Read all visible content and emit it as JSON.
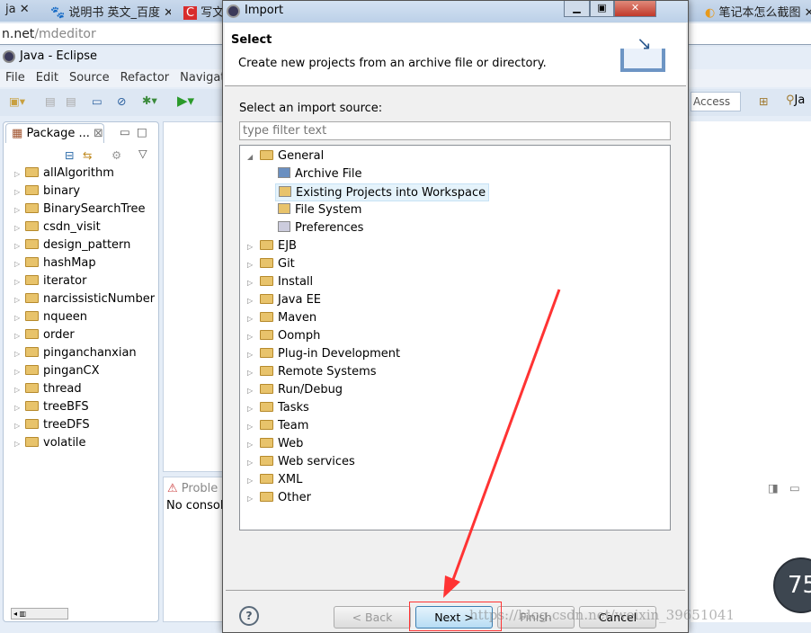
{
  "browser": {
    "tabs": [
      {
        "label": "ja"
      },
      {
        "label": "说明书 英文_百度"
      },
      {
        "label": "写文"
      },
      {
        "label": "笔记本怎么截图"
      }
    ],
    "address": {
      "host": "n.net",
      "path": "/mdeditor"
    }
  },
  "eclipse": {
    "title": "Java - Eclipse",
    "menu": [
      "File",
      "Edit",
      "Source",
      "Refactor",
      "Navigate"
    ],
    "quick_access": "Access",
    "perspective": "Ja",
    "package_explorer": {
      "tab": "Package ...",
      "projects": [
        "allAlgorithm",
        "binary",
        "BinarySearchTree",
        "csdn_visit",
        "design_pattern",
        "hashMap",
        "iterator",
        "narcissisticNumber",
        "nqueen",
        "order",
        "pinganchanxian",
        "pinganCX",
        "thread",
        "treeBFS",
        "treeDFS",
        "volatile"
      ]
    },
    "problems_tab": "Proble",
    "console_text": "No consol"
  },
  "dialog": {
    "title": "Import",
    "heading": "Select",
    "description": "Create new projects from an archive file or directory.",
    "source_label": "Select an import source:",
    "filter_placeholder": "type filter text",
    "tree": {
      "expanded": {
        "label": "General",
        "children": [
          {
            "label": "Archive File",
            "icon": "archive-icon"
          },
          {
            "label": "Existing Projects into Workspace",
            "icon": "folder-open-icon",
            "selected": true
          },
          {
            "label": "File System",
            "icon": "folder-icon"
          },
          {
            "label": "Preferences",
            "icon": "preferences-icon"
          }
        ]
      },
      "collapsed": [
        "EJB",
        "Git",
        "Install",
        "Java EE",
        "Maven",
        "Oomph",
        "Plug-in Development",
        "Remote Systems",
        "Run/Debug",
        "Tasks",
        "Team",
        "Web",
        "Web services",
        "XML",
        "Other"
      ]
    },
    "buttons": {
      "back": "< Back",
      "next": "Next >",
      "finish": "Finish",
      "cancel": "Cancel"
    }
  },
  "watermark": "https://blog.csdn.net/weixin_39651041",
  "gauge": "75",
  "colors": {
    "annotation": "#ff3333",
    "selection": "#e5f3fb"
  }
}
